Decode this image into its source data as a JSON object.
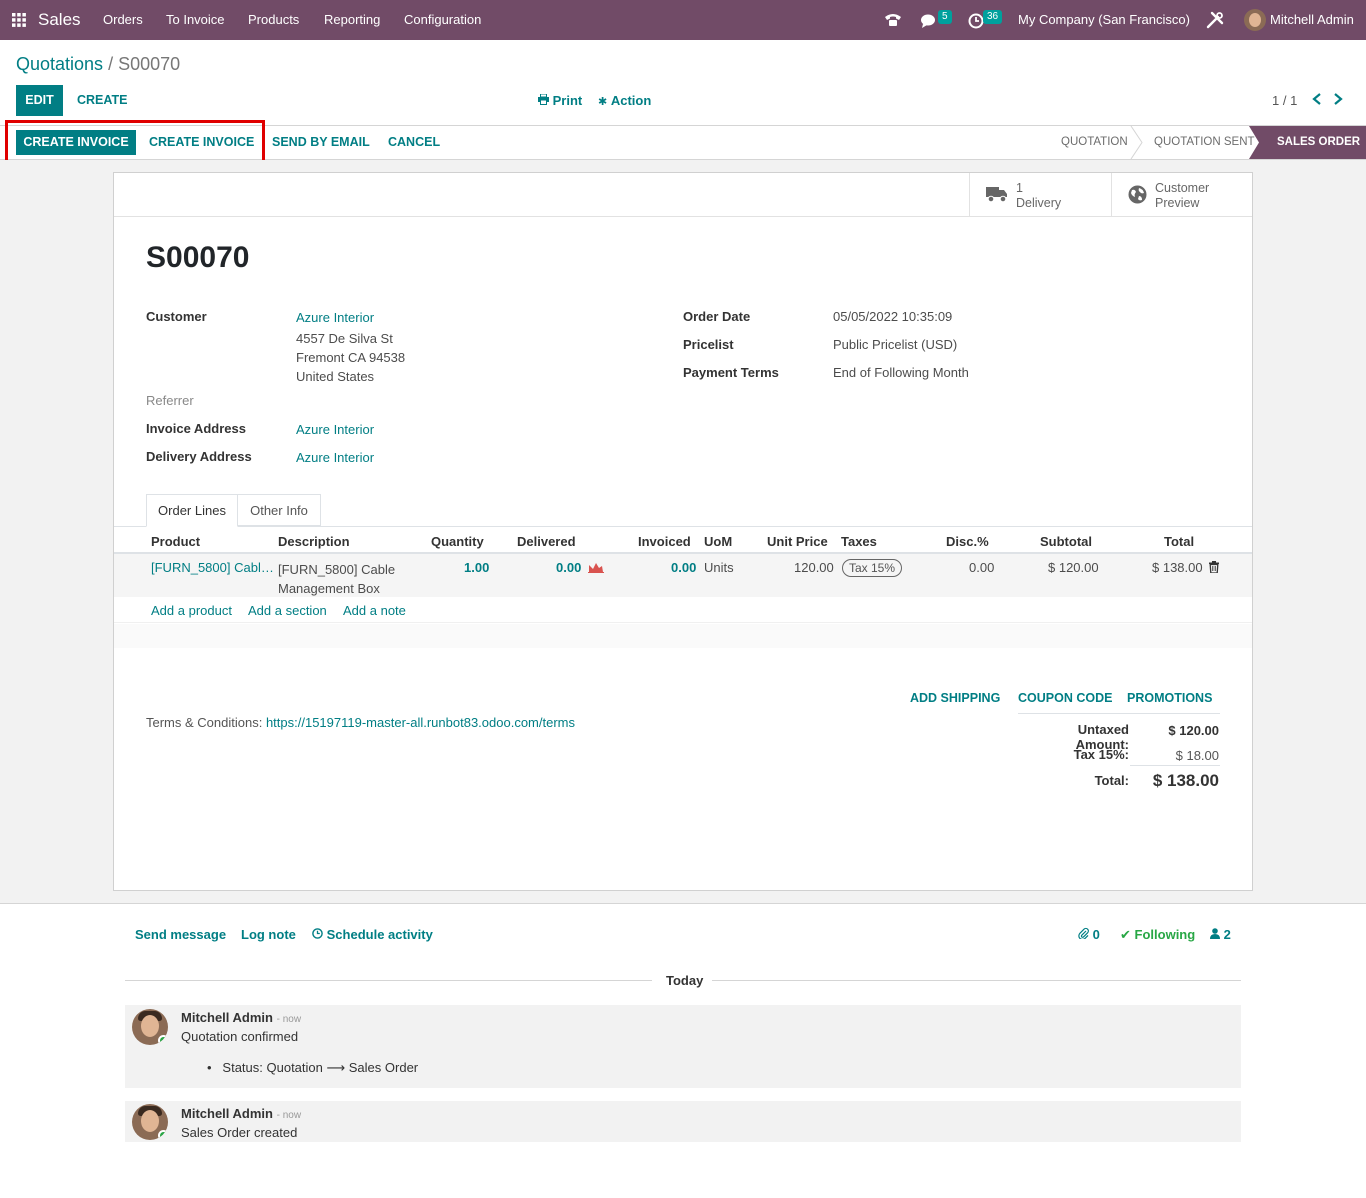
{
  "navbar": {
    "app_name": "Sales",
    "menu": [
      "Orders",
      "To Invoice",
      "Products",
      "Reporting",
      "Configuration"
    ],
    "messages_count": "5",
    "activities_count": "36",
    "company": "My Company (San Francisco)",
    "user": "Mitchell Admin"
  },
  "breadcrumb": {
    "parent": "Quotations",
    "separator": "/",
    "current": "S00070"
  },
  "controls": {
    "edit": "EDIT",
    "create": "CREATE",
    "print": "Print",
    "action": "Action",
    "pager": "1 / 1"
  },
  "actions": {
    "create_invoice_primary": "CREATE INVOICE",
    "create_invoice_secondary": "CREATE INVOICE",
    "send_by_email": "SEND BY EMAIL",
    "cancel": "CANCEL"
  },
  "stages": [
    "QUOTATION",
    "QUOTATION SENT",
    "SALES ORDER"
  ],
  "smart_buttons": {
    "delivery_count": "1",
    "delivery_label": "Delivery",
    "preview_line1": "Customer",
    "preview_line2": "Preview"
  },
  "order": {
    "name": "S00070",
    "customer_label": "Customer",
    "customer_name": "Azure Interior",
    "customer_address": [
      "4557 De Silva St",
      "Fremont CA 94538",
      "United States"
    ],
    "referrer_label": "Referrer",
    "invoice_address_label": "Invoice Address",
    "invoice_address": "Azure Interior",
    "delivery_address_label": "Delivery Address",
    "delivery_address": "Azure Interior",
    "order_date_label": "Order Date",
    "order_date": "05/05/2022 10:35:09",
    "pricelist_label": "Pricelist",
    "pricelist": "Public Pricelist (USD)",
    "payment_terms_label": "Payment Terms",
    "payment_terms": "End of Following Month"
  },
  "tabs": [
    "Order Lines",
    "Other Info"
  ],
  "table": {
    "headers": [
      "Product",
      "Description",
      "Quantity",
      "Delivered",
      "Invoiced",
      "UoM",
      "Unit Price",
      "Taxes",
      "Disc.%",
      "Subtotal",
      "Total"
    ],
    "rows": [
      {
        "product": "[FURN_5800] Cabl…",
        "description_1": "[FURN_5800] Cable",
        "description_2": "Management Box",
        "quantity": "1.00",
        "delivered": "0.00",
        "invoiced": "0.00",
        "uom": "Units",
        "unit_price": "120.00",
        "taxes": "Tax 15%",
        "discount": "0.00",
        "subtotal": "$ 120.00",
        "total": "$ 138.00"
      }
    ],
    "add_product": "Add a product",
    "add_section": "Add a section",
    "add_note": "Add a note"
  },
  "extras": {
    "add_shipping": "ADD SHIPPING",
    "coupon_code": "COUPON CODE",
    "promotions": "PROMOTIONS"
  },
  "terms": {
    "label": "Terms & Conditions:",
    "url": "https://15197119-master-all.runbot83.odoo.com/terms"
  },
  "totals": {
    "untaxed_label": "Untaxed Amount:",
    "untaxed": "$ 120.00",
    "tax_label": "Tax 15%:",
    "tax": "$ 18.00",
    "total_label": "Total:",
    "total": "$ 138.00"
  },
  "chatter": {
    "send_message": "Send message",
    "log_note": "Log note",
    "schedule_activity": "Schedule activity",
    "attachments": "0",
    "following": "Following",
    "followers": "2",
    "date_separator": "Today",
    "messages": [
      {
        "author": "Mitchell Admin",
        "time": "- now",
        "body": "Quotation confirmed",
        "tracking_field": "Status:",
        "old": "Quotation",
        "new": "Sales Order"
      },
      {
        "author": "Mitchell Admin",
        "time": "- now",
        "body": "Sales Order created"
      }
    ]
  },
  "colors": {
    "navbar": "#714b67",
    "primary": "#017e84",
    "highlight": "#e00000"
  }
}
